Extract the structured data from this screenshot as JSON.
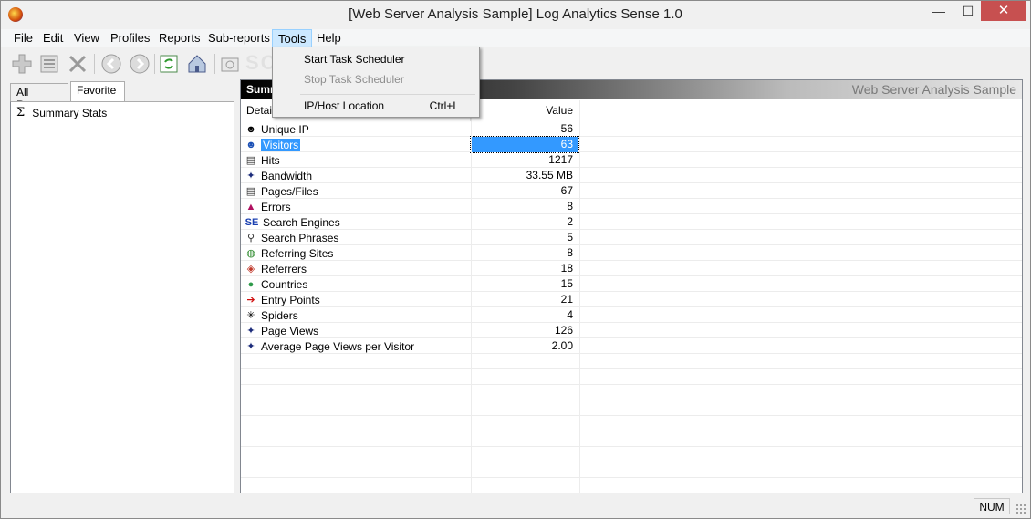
{
  "window": {
    "title": "[Web Server Analysis Sample] Log Analytics Sense 1.0",
    "min_glyph": "—",
    "max_glyph": "☐",
    "close_glyph": "✕"
  },
  "menubar": {
    "file": "File",
    "edit": "Edit",
    "view": "View",
    "profiles": "Profiles",
    "reports": "Reports",
    "subreports": "Sub-reports",
    "tools": "Tools",
    "help": "Help"
  },
  "tools_menu": {
    "start_scheduler": "Start Task Scheduler",
    "stop_scheduler": "Stop Task Scheduler",
    "ip_host_location": "IP/Host Location",
    "ip_host_shortcut": "Ctrl+L"
  },
  "toolbar_icons": [
    "add-icon",
    "list-icon",
    "delete-icon",
    "back-icon",
    "forward-icon",
    "refresh-icon",
    "home-icon",
    "export-icon"
  ],
  "left_tabs": {
    "all_reports": "All Reports",
    "favorite": "Favorite"
  },
  "tree": {
    "summary_stats": "Summary Stats"
  },
  "report": {
    "header_left": "Summ",
    "header_right": "Web Server Analysis Sample",
    "col_detail": "Detai",
    "col_value": "Value",
    "rows": [
      {
        "label": "Unique IP",
        "value": "56",
        "icon": "person-icon",
        "glyph": "☻",
        "color": "#000"
      },
      {
        "label": "Visitors",
        "value": "63",
        "icon": "visitor-icon",
        "glyph": "☻",
        "color": "#1a4fb5"
      },
      {
        "label": "Hits",
        "value": "1217",
        "icon": "document-icon",
        "glyph": "▤",
        "color": "#333"
      },
      {
        "label": "Bandwidth",
        "value": "33.55 MB",
        "icon": "star-icon",
        "glyph": "✦",
        "color": "#1b2b7a"
      },
      {
        "label": "Pages/Files",
        "value": "67",
        "icon": "page-icon",
        "glyph": "▤",
        "color": "#333"
      },
      {
        "label": "Errors",
        "value": "8",
        "icon": "error-icon",
        "glyph": "▲",
        "color": "#b01060"
      },
      {
        "label": "Search Engines",
        "value": "2",
        "icon": "search-engine-icon",
        "glyph": "SE",
        "color": "#1a3fb0"
      },
      {
        "label": "Search Phrases",
        "value": "5",
        "icon": "magnifier-icon",
        "glyph": "⚲",
        "color": "#333"
      },
      {
        "label": "Referring Sites",
        "value": "8",
        "icon": "globe-people-icon",
        "glyph": "◍",
        "color": "#2e8b2e"
      },
      {
        "label": "Referrers",
        "value": "18",
        "icon": "referrer-icon",
        "glyph": "◈",
        "color": "#c0392b"
      },
      {
        "label": "Countries",
        "value": "15",
        "icon": "globe-icon",
        "glyph": "●",
        "color": "#2e9a4a"
      },
      {
        "label": "Entry Points",
        "value": "21",
        "icon": "entry-icon",
        "glyph": "➔",
        "color": "#d01010"
      },
      {
        "label": "Spiders",
        "value": "4",
        "icon": "spider-icon",
        "glyph": "✳",
        "color": "#000"
      },
      {
        "label": "Page Views",
        "value": "126",
        "icon": "star-icon",
        "glyph": "✦",
        "color": "#1b2b7a"
      },
      {
        "label": "Average Page Views per Visitor",
        "value": "2.00",
        "icon": "star-icon",
        "glyph": "✦",
        "color": "#1b2b7a"
      }
    ],
    "selected_row": "Visitors"
  },
  "status": {
    "num": "NUM"
  }
}
